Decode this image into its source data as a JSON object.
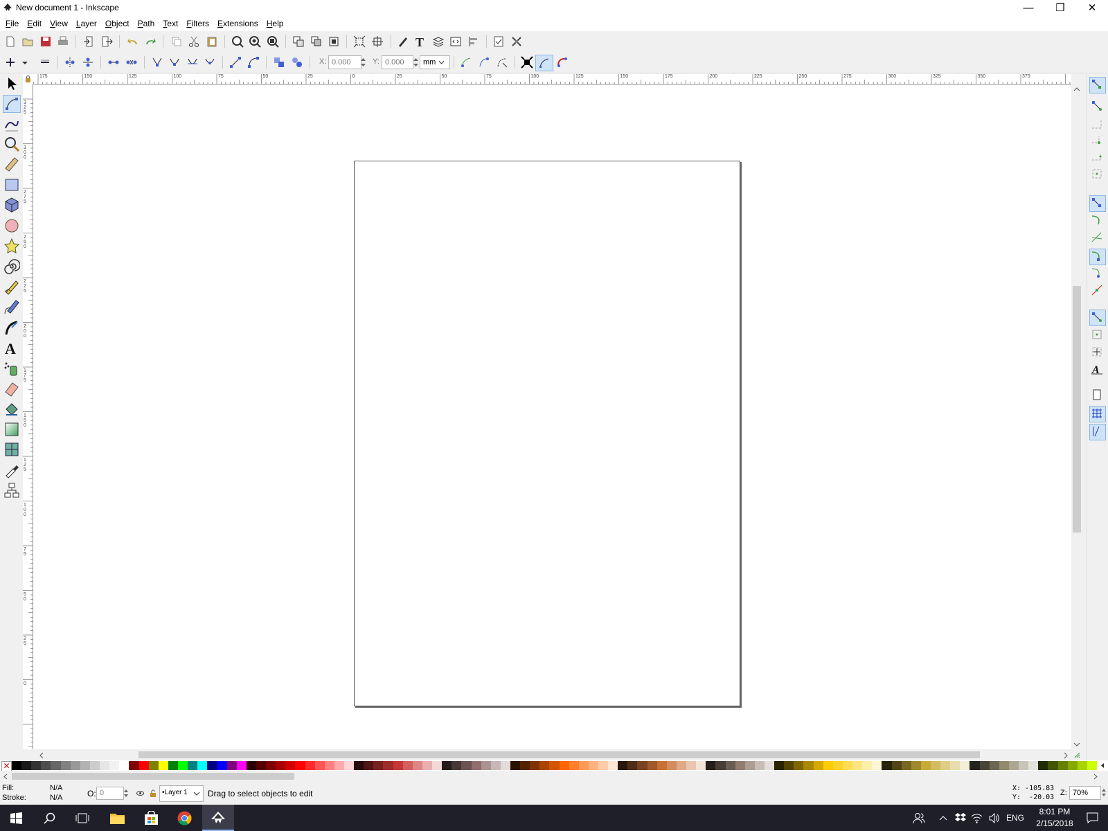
{
  "window": {
    "title": "New document 1 - Inkscape",
    "min_glyph": "—",
    "max_glyph": "❐",
    "close_glyph": "✕"
  },
  "menu": [
    "File",
    "Edit",
    "View",
    "Layer",
    "Object",
    "Path",
    "Text",
    "Filters",
    "Extensions",
    "Help"
  ],
  "node_toolbar": {
    "x_label": "X:",
    "x_value": "0.000",
    "y_label": "Y:",
    "y_value": "0.000",
    "unit": "mm"
  },
  "ruler_top_labels": [
    "175",
    "150",
    "125",
    "100",
    "75",
    "50",
    "25",
    "0",
    "25",
    "50",
    "75",
    "100",
    "125",
    "150",
    "175",
    "200",
    "225",
    "250",
    "275",
    "300",
    "325",
    "350",
    "375"
  ],
  "ruler_left_labels": [
    "325",
    "300",
    "275",
    "250",
    "225",
    "200",
    "175",
    "150",
    "125",
    "100",
    "75",
    "50",
    "25",
    "0"
  ],
  "palette": {
    "none_glyph": "✕",
    "colors": [
      "#000000",
      "#1a1a1a",
      "#333333",
      "#4d4d4d",
      "#666666",
      "#808080",
      "#999999",
      "#b3b3b3",
      "#cccccc",
      "#e6e6e6",
      "#f2f2f2",
      "#ffffff",
      "#800000",
      "#ff0000",
      "#808000",
      "#ffff00",
      "#008000",
      "#00ff00",
      "#008080",
      "#00ffff",
      "#000080",
      "#0000ff",
      "#800080",
      "#ff00ff",
      "#2b0000",
      "#550000",
      "#800000",
      "#aa0000",
      "#d40000",
      "#ff0000",
      "#ff2a2a",
      "#ff5555",
      "#ff8080",
      "#ffaaaa",
      "#ffd5d5",
      "#280b0b",
      "#501616",
      "#782121",
      "#a02c2c",
      "#c83737",
      "#d35f5f",
      "#de8787",
      "#e9afaf",
      "#f4d7d7",
      "#241c1c",
      "#483737",
      "#6c5353",
      "#916f6f",
      "#ac9393",
      "#c8b7b7",
      "#e3dbdb",
      "#2b1100",
      "#552200",
      "#803300",
      "#aa4400",
      "#d45500",
      "#ff6600",
      "#ff7f2a",
      "#ff9955",
      "#ffb380",
      "#ffccaa",
      "#ffe6d5",
      "#28170b",
      "#502d16",
      "#784421",
      "#a05a2c",
      "#c87137",
      "#d38d5f",
      "#deaa87",
      "#e9c6af",
      "#f4e3d7",
      "#241f1c",
      "#483e37",
      "#6c5d53",
      "#917c6f",
      "#ac9d93",
      "#c8beb7",
      "#e3dedb",
      "#2b2200",
      "#554400",
      "#806600",
      "#aa8800",
      "#d4aa00",
      "#ffcc00",
      "#ffd42a",
      "#ffdd55",
      "#ffe680",
      "#ffeeaa",
      "#fff6d5",
      "#28220b",
      "#504416",
      "#786721",
      "#a0892c",
      "#c8ab37",
      "#d3bc5f",
      "#decd87",
      "#e9ddaf",
      "#f4eed7",
      "#24221c",
      "#484537",
      "#6c6753",
      "#918a6f",
      "#aca793",
      "#c8c4b7",
      "#e3e2db",
      "#222b00",
      "#445500",
      "#668000",
      "#88aa00",
      "#aad400",
      "#ccff00"
    ]
  },
  "status": {
    "fill_label": "Fill:",
    "fill_value": "N/A",
    "stroke_label": "Stroke:",
    "stroke_value": "N/A",
    "opacity_label": "O:",
    "opacity_value": "0",
    "layer_name": "•Layer 1",
    "message": "Drag to select objects to edit",
    "cursor_x": "X: -105.83",
    "cursor_y": "Y:  -20.03",
    "zoom_label": "Z:",
    "zoom_value": "70%"
  },
  "taskbar": {
    "time": "8:01 PM",
    "date": "2/15/2018",
    "language": "ENG"
  }
}
